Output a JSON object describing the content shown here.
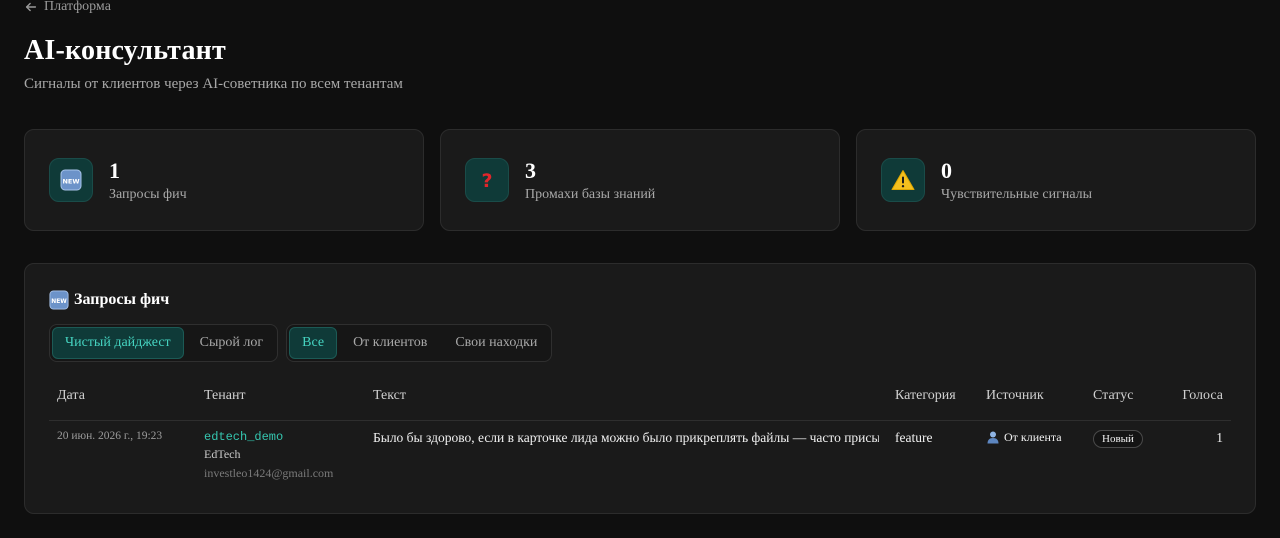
{
  "breadcrumb": {
    "label": "Платформа",
    "icon": "arrow-left-icon"
  },
  "header": {
    "title": "AI-консультант",
    "subtitle": "Сигналы от клиентов через AI-советника по всем тенантам"
  },
  "stats": [
    {
      "value": "1",
      "label": "Запросы фич",
      "icon": "new-icon"
    },
    {
      "value": "3",
      "label": "Промахи базы знаний",
      "icon": "question-icon"
    },
    {
      "value": "0",
      "label": "Чувствительные сигналы",
      "icon": "warning-icon"
    }
  ],
  "panel": {
    "title": "Запросы фич",
    "title_icon": "new-icon",
    "view_toggle": {
      "digest": "Чистый дайджест",
      "raw": "Сырой лог"
    },
    "filter_toggle": {
      "all": "Все",
      "clients": "От клиентов",
      "own": "Свои находки"
    },
    "columns": {
      "date": "Дата",
      "tenant": "Тенант",
      "text": "Текст",
      "category": "Категория",
      "source": "Источник",
      "status": "Статус",
      "votes": "Голоса"
    },
    "rows": [
      {
        "date": "20 июн. 2026 г., 19:23",
        "tenant_code": "edtech_demo",
        "tenant_name": "EdTech",
        "tenant_email": "investleo1424@gmail.com",
        "text": "Было бы здорово, если в карточке лида можно было прикреплять файлы — часто присылают документы",
        "category": "feature",
        "source": "От клиента",
        "status": "Новый",
        "votes": "1"
      }
    ]
  },
  "colors": {
    "accent": "#35c6b0",
    "accent_bg": "#0f3a38",
    "background": "#0f0f0f",
    "card": "#1a1a1a"
  }
}
